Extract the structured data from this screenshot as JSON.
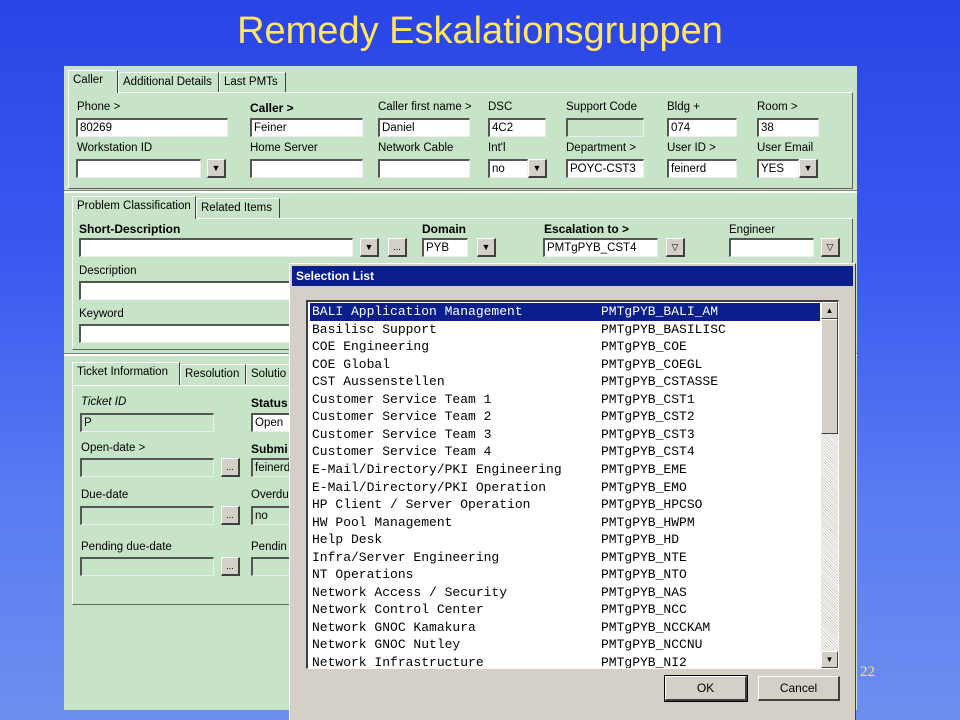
{
  "slide": {
    "title": "Remedy Eskalationsgruppen",
    "page_number": "22"
  },
  "caller_tabs": [
    {
      "label": "Caller",
      "active": true
    },
    {
      "label": "Additional Details",
      "active": false
    },
    {
      "label": "Last PMTs",
      "active": false
    }
  ],
  "caller": {
    "phone_label": "Phone >",
    "phone_value": "80269",
    "caller_label": "Caller >",
    "caller_value": "Feiner",
    "first_name_label": "Caller first name >",
    "first_name_value": "Daniel",
    "dsc_label": "DSC",
    "dsc_value": "4C2",
    "support_code_label": "Support Code",
    "support_code_value": "",
    "bldg_label": "Bldg +",
    "bldg_value": "074",
    "room_label": "Room >",
    "room_value": "38",
    "workstation_label": "Workstation ID",
    "workstation_value": "",
    "home_server_label": "Home Server",
    "home_server_value": "",
    "network_cable_label": "Network Cable",
    "network_cable_value": "",
    "intl_label": "Int'l",
    "intl_value": "no",
    "department_label": "Department >",
    "department_value": "POYC-CST3",
    "user_id_label": "User ID >",
    "user_id_value": "feinerd",
    "user_email_label": "User Email",
    "user_email_value": "YES"
  },
  "problem_tabs": [
    {
      "label": "Problem Classification",
      "active": true
    },
    {
      "label": "Related Items",
      "active": false
    }
  ],
  "problem": {
    "short_desc_label": "Short-Description",
    "short_desc_value": "",
    "domain_label": "Domain",
    "domain_value": "PYB",
    "escalation_label": "Escalation to >",
    "escalation_value": "PMTgPYB_CST4",
    "engineer_label": "Engineer",
    "engineer_value": "",
    "description_label": "Description",
    "keyword_label": "Keyword",
    "ellipsis": "..."
  },
  "ticket_tabs": [
    {
      "label": "Ticket Information",
      "active": true
    },
    {
      "label": "Resolution",
      "active": false
    },
    {
      "label": "Solutio",
      "active": false
    }
  ],
  "ticket": {
    "ticket_id_label": "Ticket ID",
    "ticket_id_value": "P",
    "status_label": "Status",
    "status_value": "Open",
    "open_date_label": "Open-date >",
    "submitter_label": "Submi",
    "submitter_value": "feinerd",
    "due_date_label": "Due-date",
    "overdue_label": "Overdu",
    "overdue_value": "no",
    "pending_due_label": "Pending due-date",
    "pending_label": "Pendin"
  },
  "selection_dialog": {
    "title": "Selection List",
    "ok_label": "OK",
    "cancel_label": "Cancel",
    "items": [
      {
        "name": "BALI Application Management",
        "group": "PMTgPYB_BALI_AM",
        "selected": true
      },
      {
        "name": "Basilisc Support",
        "group": "PMTgPYB_BASILISC",
        "selected": false
      },
      {
        "name": "COE Engineering",
        "group": "PMTgPYB_COE",
        "selected": false
      },
      {
        "name": "COE Global",
        "group": "PMTgPYB_COEGL",
        "selected": false
      },
      {
        "name": "CST Aussenstellen",
        "group": "PMTgPYB_CSTASSE",
        "selected": false
      },
      {
        "name": "Customer Service Team 1",
        "group": "PMTgPYB_CST1",
        "selected": false
      },
      {
        "name": "Customer Service Team 2",
        "group": "PMTgPYB_CST2",
        "selected": false
      },
      {
        "name": "Customer Service Team 3",
        "group": "PMTgPYB_CST3",
        "selected": false
      },
      {
        "name": "Customer Service Team 4",
        "group": "PMTgPYB_CST4",
        "selected": false
      },
      {
        "name": "E-Mail/Directory/PKI Engineering",
        "group": "PMTgPYB_EME",
        "selected": false
      },
      {
        "name": "E-Mail/Directory/PKI Operation",
        "group": "PMTgPYB_EMO",
        "selected": false
      },
      {
        "name": "HP Client / Server Operation",
        "group": "PMTgPYB_HPCSO",
        "selected": false
      },
      {
        "name": "HW Pool Management",
        "group": "PMTgPYB_HWPM",
        "selected": false
      },
      {
        "name": "Help Desk",
        "group": "PMTgPYB_HD",
        "selected": false
      },
      {
        "name": "Infra/Server Engineering",
        "group": "PMTgPYB_NTE",
        "selected": false
      },
      {
        "name": "NT Operations",
        "group": "PMTgPYB_NTO",
        "selected": false
      },
      {
        "name": "Network Access / Security",
        "group": "PMTgPYB_NAS",
        "selected": false
      },
      {
        "name": "Network Control Center",
        "group": "PMTgPYB_NCC",
        "selected": false
      },
      {
        "name": "Network GNOC Kamakura",
        "group": "PMTgPYB_NCCKAM",
        "selected": false
      },
      {
        "name": "Network GNOC Nutley",
        "group": "PMTgPYB_NCCNU",
        "selected": false
      },
      {
        "name": "Network Infrastructure",
        "group": "PMTgPYB_NI2",
        "selected": false
      }
    ]
  },
  "icons": {
    "dropdown": "chevron-down-icon",
    "scroll_up": "scroll-up-arrow-icon",
    "scroll_down": "scroll-down-arrow-icon"
  },
  "colors": {
    "slide_bg": "#2a45e6",
    "title": "#ffe566",
    "form_bg": "#c8e4c8",
    "selection": "#0a1f8c"
  }
}
